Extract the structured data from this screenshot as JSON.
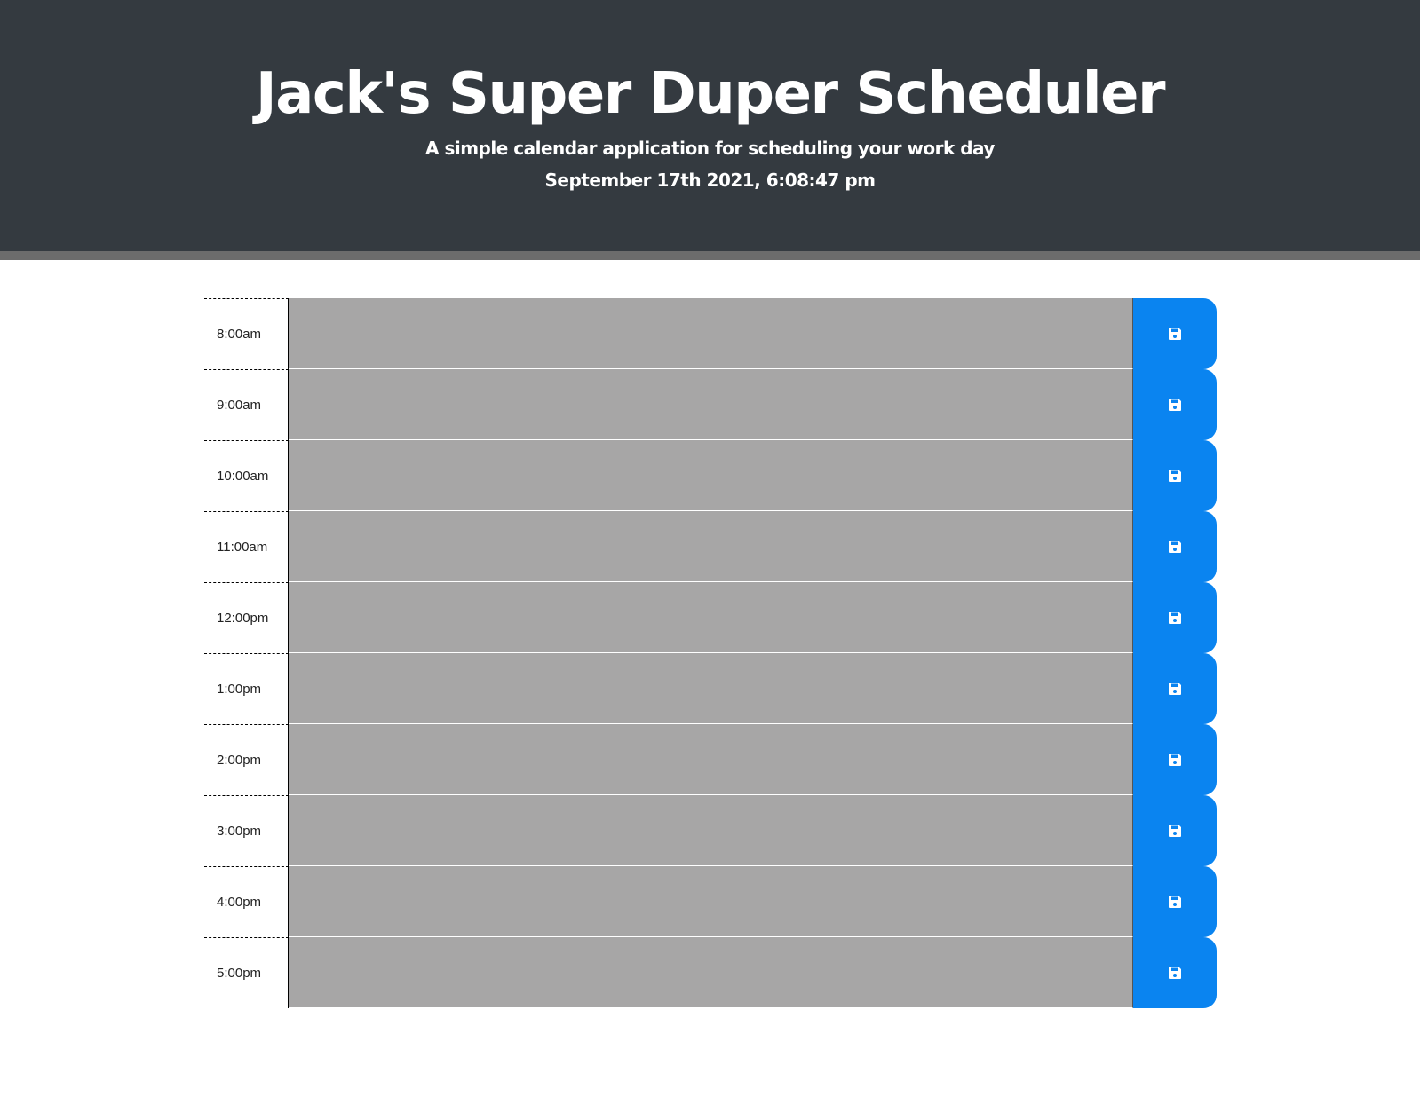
{
  "header": {
    "title": "Jack's Super Duper Scheduler",
    "subtitle": "A simple calendar application for scheduling your work day",
    "current_day": "September 17th 2021, 6:08:47 pm"
  },
  "colors": {
    "header_bg": "#343a40",
    "row_bg": "#a7a6a6",
    "save_button": "#0a84f0"
  },
  "time_blocks": [
    {
      "hour": "8:00am",
      "description": "",
      "save_icon": "floppy-disk-icon"
    },
    {
      "hour": "9:00am",
      "description": "",
      "save_icon": "floppy-disk-icon"
    },
    {
      "hour": "10:00am",
      "description": "",
      "save_icon": "floppy-disk-icon"
    },
    {
      "hour": "11:00am",
      "description": "",
      "save_icon": "floppy-disk-icon"
    },
    {
      "hour": "12:00pm",
      "description": "",
      "save_icon": "floppy-disk-icon"
    },
    {
      "hour": "1:00pm",
      "description": "",
      "save_icon": "floppy-disk-icon"
    },
    {
      "hour": "2:00pm",
      "description": "",
      "save_icon": "floppy-disk-icon"
    },
    {
      "hour": "3:00pm",
      "description": "",
      "save_icon": "floppy-disk-icon"
    },
    {
      "hour": "4:00pm",
      "description": "",
      "save_icon": "floppy-disk-icon"
    },
    {
      "hour": "5:00pm",
      "description": "",
      "save_icon": "floppy-disk-icon"
    }
  ]
}
